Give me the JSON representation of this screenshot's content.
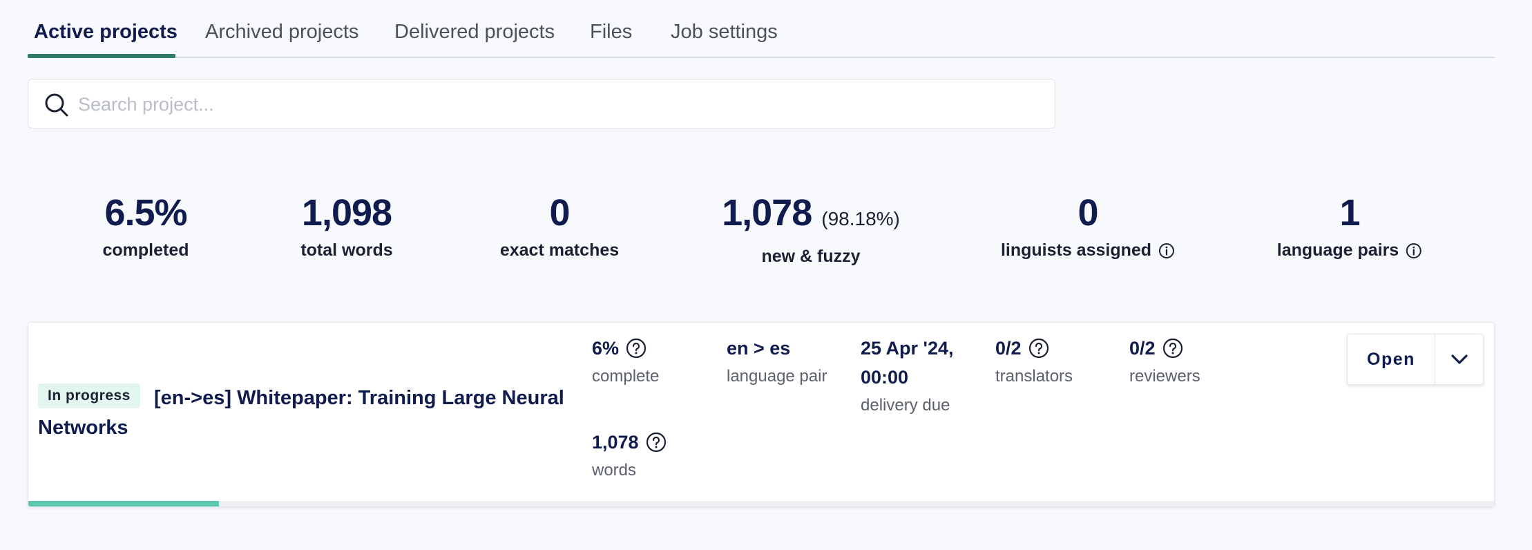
{
  "tabs": [
    {
      "label": "Active projects",
      "active": true
    },
    {
      "label": "Archived projects",
      "active": false
    },
    {
      "label": "Delivered projects",
      "active": false
    },
    {
      "label": "Files",
      "active": false
    },
    {
      "label": "Job settings",
      "active": false
    }
  ],
  "search": {
    "placeholder": "Search project...",
    "value": ""
  },
  "stats": {
    "completed": {
      "value": "6.5%",
      "label": "completed"
    },
    "total_words": {
      "value": "1,098",
      "label": "total words"
    },
    "exact_matches": {
      "value": "0",
      "label": "exact matches"
    },
    "new_fuzzy": {
      "value": "1,078",
      "suffix": "(98.18%)",
      "label": "new & fuzzy"
    },
    "linguists_assigned": {
      "value": "0",
      "label": "linguists assigned",
      "icon": "info-icon"
    },
    "language_pairs": {
      "value": "1",
      "label": "language pairs",
      "icon": "info-icon"
    }
  },
  "project": {
    "status": "In progress",
    "title": "[en->es] Whitepaper: Training Large Neural Networks",
    "complete": {
      "value": "6%",
      "label": "complete"
    },
    "words": {
      "value": "1,078",
      "label": "words"
    },
    "language_pair": {
      "value": "en > es",
      "label": "language pair"
    },
    "delivery": {
      "value_line1": "25 Apr '24,",
      "value_line2": "00:00",
      "label": "delivery due"
    },
    "translators": {
      "value": "0/2",
      "label": "translators"
    },
    "reviewers": {
      "value": "0/2",
      "label": "reviewers"
    },
    "progress_fraction": 0.13,
    "open_label": "Open",
    "toggle_icon": "chevron-down-icon"
  },
  "colors": {
    "primary_text": "#0f1c4d",
    "tab_indicator": "#2e7d64",
    "badge_bg": "#e3f5ef",
    "progress": "#5cc8ad",
    "page_bg": "#f8f9fc"
  }
}
